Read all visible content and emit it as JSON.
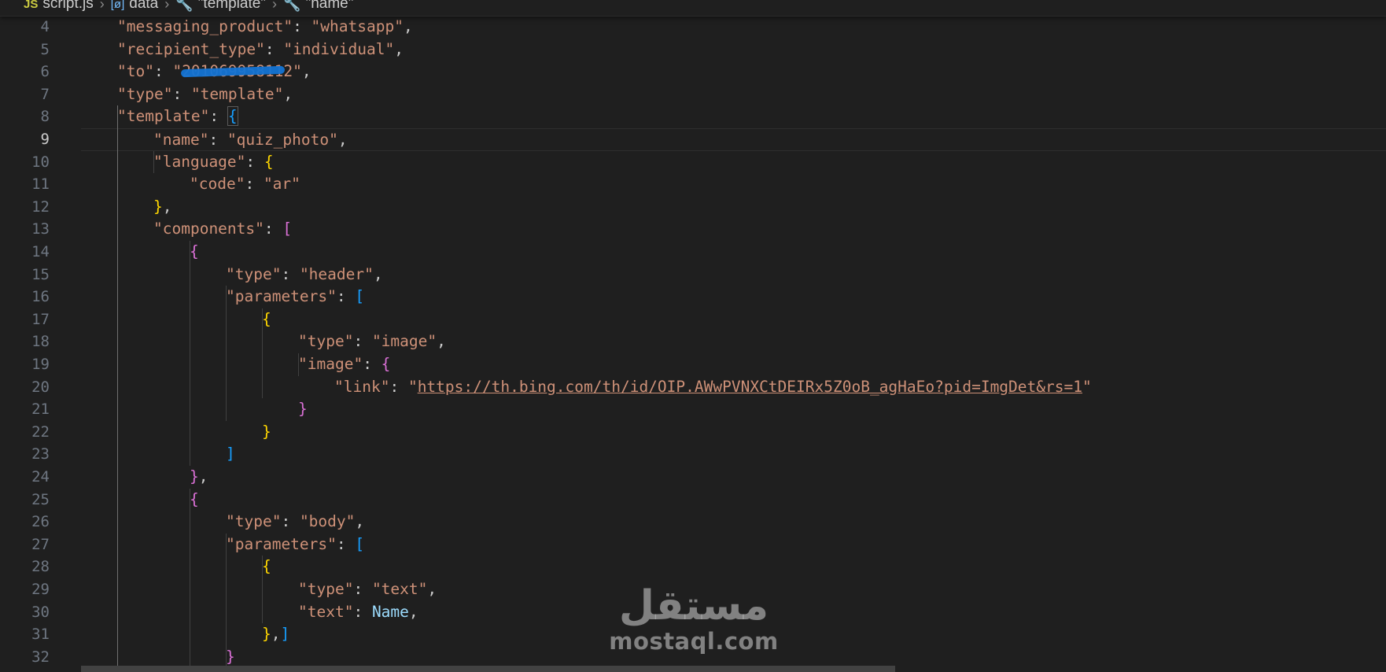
{
  "breadcrumb": {
    "file_icon": "JS",
    "file_name": "script.js",
    "sep": "›",
    "object_icon": "[ø]",
    "object_name": "data",
    "wrench_icon": "🔧",
    "key1": "\"template\"",
    "key2": "\"name\""
  },
  "editor": {
    "current_line": 9,
    "lines": [
      {
        "n": "4",
        "t": {
          "k": "\"messaging_product\"",
          "c": ": ",
          "v": "\"whatsapp\"",
          "e": ","
        }
      },
      {
        "n": "5",
        "t": {
          "k": "\"recipient_type\"",
          "c": ": ",
          "v": "\"individual\"",
          "e": ","
        }
      },
      {
        "n": "6",
        "t": {
          "k": "\"to\"",
          "c": ": ",
          "v": "\"201069958112\"",
          "e": ","
        }
      },
      {
        "n": "7",
        "t": {
          "k": "\"type\"",
          "c": ": ",
          "v": "\"template\"",
          "e": ","
        }
      },
      {
        "n": "8",
        "t": {
          "k": "\"template\"",
          "c": ": ",
          "o": "{"
        }
      },
      {
        "n": "9",
        "t": {
          "k": "\"name\"",
          "c": ": ",
          "v": "\"quiz_photo\"",
          "e": ","
        }
      },
      {
        "n": "10",
        "t": {
          "k": "\"language\"",
          "c": ": ",
          "o": "{"
        }
      },
      {
        "n": "11",
        "t": {
          "k": "\"code\"",
          "c": ": ",
          "v": "\"ar\""
        }
      },
      {
        "n": "12",
        "t": {
          "o": "}",
          "e": ","
        }
      },
      {
        "n": "13",
        "t": {
          "k": "\"components\"",
          "c": ": ",
          "o": "["
        }
      },
      {
        "n": "14",
        "t": {
          "o": "{"
        }
      },
      {
        "n": "15",
        "t": {
          "k": "\"type\"",
          "c": ": ",
          "v": "\"header\"",
          "e": ","
        }
      },
      {
        "n": "16",
        "t": {
          "k": "\"parameters\"",
          "c": ": ",
          "o": "["
        }
      },
      {
        "n": "17",
        "t": {
          "o": "{"
        }
      },
      {
        "n": "18",
        "t": {
          "k": "\"type\"",
          "c": ": ",
          "v": "\"image\"",
          "e": ","
        }
      },
      {
        "n": "19",
        "t": {
          "k": "\"image\"",
          "c": ": ",
          "o": "{"
        }
      },
      {
        "n": "20",
        "t": {
          "k": "\"link\"",
          "c": ": ",
          "q": "\"",
          "u": "https://th.bing.com/th/id/OIP.AWwPVNXCtDEIRx5Z0oB_agHaEo?pid=ImgDet&rs=1",
          "q2": "\""
        }
      },
      {
        "n": "21",
        "t": {
          "o": "}"
        }
      },
      {
        "n": "22",
        "t": {
          "o": "}"
        }
      },
      {
        "n": "23",
        "t": {
          "o": "]"
        }
      },
      {
        "n": "24",
        "t": {
          "o": "}",
          "e": ","
        }
      },
      {
        "n": "25",
        "t": {
          "o": "{"
        }
      },
      {
        "n": "26",
        "t": {
          "k": "\"type\"",
          "c": ": ",
          "v": "\"body\"",
          "e": ","
        }
      },
      {
        "n": "27",
        "t": {
          "k": "\"parameters\"",
          "c": ": ",
          "o": "["
        }
      },
      {
        "n": "28",
        "t": {
          "o": "{"
        }
      },
      {
        "n": "29",
        "t": {
          "k": "\"type\"",
          "c": ": ",
          "v": "\"text\"",
          "e": ","
        }
      },
      {
        "n": "30",
        "t": {
          "k": "\"text\"",
          "c": ": ",
          "id": "Name",
          "e": ","
        }
      },
      {
        "n": "31",
        "t": {
          "o": "}",
          "e": ",",
          "o2": "]"
        }
      },
      {
        "n": "32",
        "t": {
          "o": "}"
        }
      }
    ]
  },
  "watermark": {
    "arabic": "مستقل",
    "latin": "mostaql.com"
  },
  "colors": {
    "background": "#1f1f1f",
    "string": "#ce9178",
    "variable": "#9cdcfe",
    "bracket_gold": "#ffd700",
    "bracket_orchid": "#da70d6",
    "bracket_blue": "#179fff",
    "redaction": "#1474d4"
  }
}
